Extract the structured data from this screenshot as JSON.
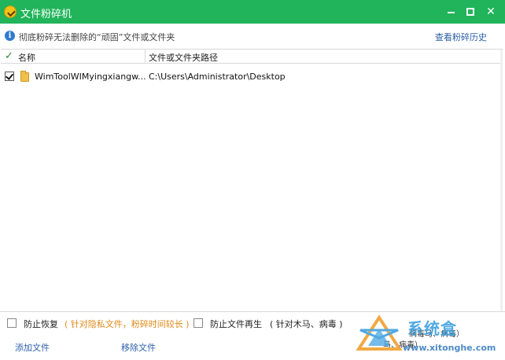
{
  "window": {
    "title": "文件粉碎机",
    "controls": {
      "minimize": "minimize",
      "maximize": "maximize",
      "close": "✕"
    }
  },
  "info": {
    "text": "彻底粉碎无法删除的“顽固”文件或文件夹",
    "history_link": "查看粉碎历史"
  },
  "table": {
    "columns": [
      "名称",
      "文件或文件夹路径"
    ],
    "rows": [
      {
        "checked": true,
        "name": "WimToolWIMyingxiangw...",
        "path": "C:\\Users\\Administrator\\Desktop"
      }
    ]
  },
  "footer": {
    "option1_label": "防止恢复",
    "option1_note": "( 针对隐私文件，粉碎时间较长 )",
    "option2_label": "防止文件再生",
    "option2_note": "( 针对木马、病毒 )",
    "add_button": "添加文件",
    "remove_button": "移除文件",
    "overflow_line1": "病毒马、病毒）",
    "overflow_line2": "马、病毒）"
  },
  "watermark": {
    "brand": "系统盒",
    "url": "www.xitonghe.com"
  },
  "colors": {
    "titlebar": "#21b45a",
    "link": "#2a5fa8",
    "note_orange": "#e08a1a"
  }
}
